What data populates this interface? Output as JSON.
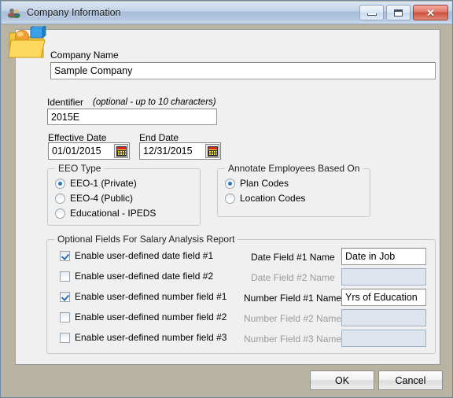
{
  "window": {
    "title": "Company Information",
    "icon": "people-icon",
    "buttons": {
      "minimize": "minimize-button",
      "maximize": "maximize-button",
      "close": "close-button"
    },
    "accent_titlebar": "#b3c7e0",
    "background": "#b9b4a1",
    "panel_background": "#f0f0f0",
    "close_color": "#cf4f3d"
  },
  "form": {
    "company_name": {
      "label": "Company Name",
      "value": "Sample Company",
      "placeholder": ""
    },
    "identifier": {
      "label": "Identifier",
      "hint": "(optional - up to 10 characters)",
      "value": "2015E",
      "placeholder": ""
    },
    "effective_date": {
      "label": "Effective Date",
      "value": "01/01/2015",
      "icon": "calendar-icon"
    },
    "end_date": {
      "label": "End Date",
      "value": "12/31/2015",
      "icon": "calendar-icon"
    }
  },
  "eeo_type": {
    "title": "EEO Type",
    "options": [
      {
        "label": "EEO-1 (Private)",
        "checked": true
      },
      {
        "label": "EEO-4 (Public)",
        "checked": false
      },
      {
        "label": "Educational - IPEDS",
        "checked": false
      }
    ]
  },
  "annotate": {
    "title": "Annotate Employees Based On",
    "options": [
      {
        "label": "Plan Codes",
        "checked": true
      },
      {
        "label": "Location Codes",
        "checked": false
      }
    ]
  },
  "optional_fields": {
    "title": "Optional Fields For Salary Analysis Report",
    "rows": [
      {
        "checkbox_label": "Enable user-defined date field #1",
        "checked": true,
        "name_label": "Date Field #1 Name",
        "value": "Date in Job",
        "enabled": true
      },
      {
        "checkbox_label": "Enable user-defined date field #2",
        "checked": false,
        "name_label": "Date Field #2 Name",
        "value": "",
        "enabled": false
      },
      {
        "checkbox_label": "Enable user-defined number field #1",
        "checked": true,
        "name_label": "Number Field #1 Name",
        "value": "Yrs of Education",
        "enabled": true
      },
      {
        "checkbox_label": "Enable user-defined number field #2",
        "checked": false,
        "name_label": "Number Field #2 Name",
        "value": "",
        "enabled": false
      },
      {
        "checkbox_label": "Enable user-defined number field #3",
        "checked": false,
        "name_label": "Number Field #3 Name",
        "value": "",
        "enabled": false
      }
    ]
  },
  "footer": {
    "ok_label": "OK",
    "cancel_label": "Cancel"
  }
}
